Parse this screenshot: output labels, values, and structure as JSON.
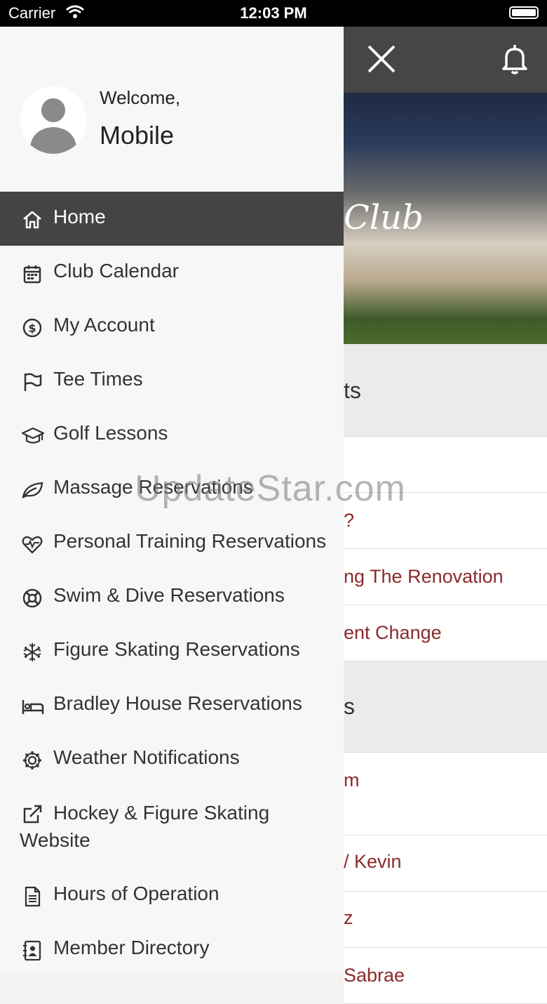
{
  "status_bar": {
    "carrier": "Carrier",
    "time": "12:03 PM"
  },
  "profile": {
    "welcome": "Welcome,",
    "name": "Mobile"
  },
  "menu": [
    {
      "label": "Home",
      "icon": "home-icon",
      "active": true
    },
    {
      "label": "Club Calendar",
      "icon": "calendar-icon"
    },
    {
      "label": "My Account",
      "icon": "dollar-icon"
    },
    {
      "label": "Tee Times",
      "icon": "flag-icon"
    },
    {
      "label": "Golf Lessons",
      "icon": "graduation-cap-icon"
    },
    {
      "label": "Massage Reservations",
      "icon": "leaf-icon"
    },
    {
      "label": "Personal Training Reservations",
      "icon": "heartbeat-icon"
    },
    {
      "label": "Swim & Dive Reservations",
      "icon": "life-ring-icon"
    },
    {
      "label": "Figure Skating Reservations",
      "icon": "snowflake-icon"
    },
    {
      "label": "Bradley House Reservations",
      "icon": "bed-icon"
    },
    {
      "label": "Weather Notifications",
      "icon": "gear-icon"
    },
    {
      "label": "Hockey & Figure Skating Website",
      "icon": "external-link-icon"
    },
    {
      "label": "Hours of Operation",
      "icon": "document-icon"
    },
    {
      "label": "Member Directory",
      "icon": "contact-book-icon"
    }
  ],
  "background": {
    "hero_text": "Club",
    "section1_tail": "ts",
    "section1_rows": [
      "?",
      "ng The Renovation",
      "ent Change"
    ],
    "section2_tail": "s",
    "section2_rows": [
      "m",
      "/ Kevin",
      "z",
      "Sabrae"
    ]
  },
  "watermark": "UpdateStar.com",
  "colors": {
    "drawer_bg": "#f7f7f7",
    "active_bg": "#444444",
    "link_color": "#8a2b2b",
    "header_bg": "#464646"
  }
}
